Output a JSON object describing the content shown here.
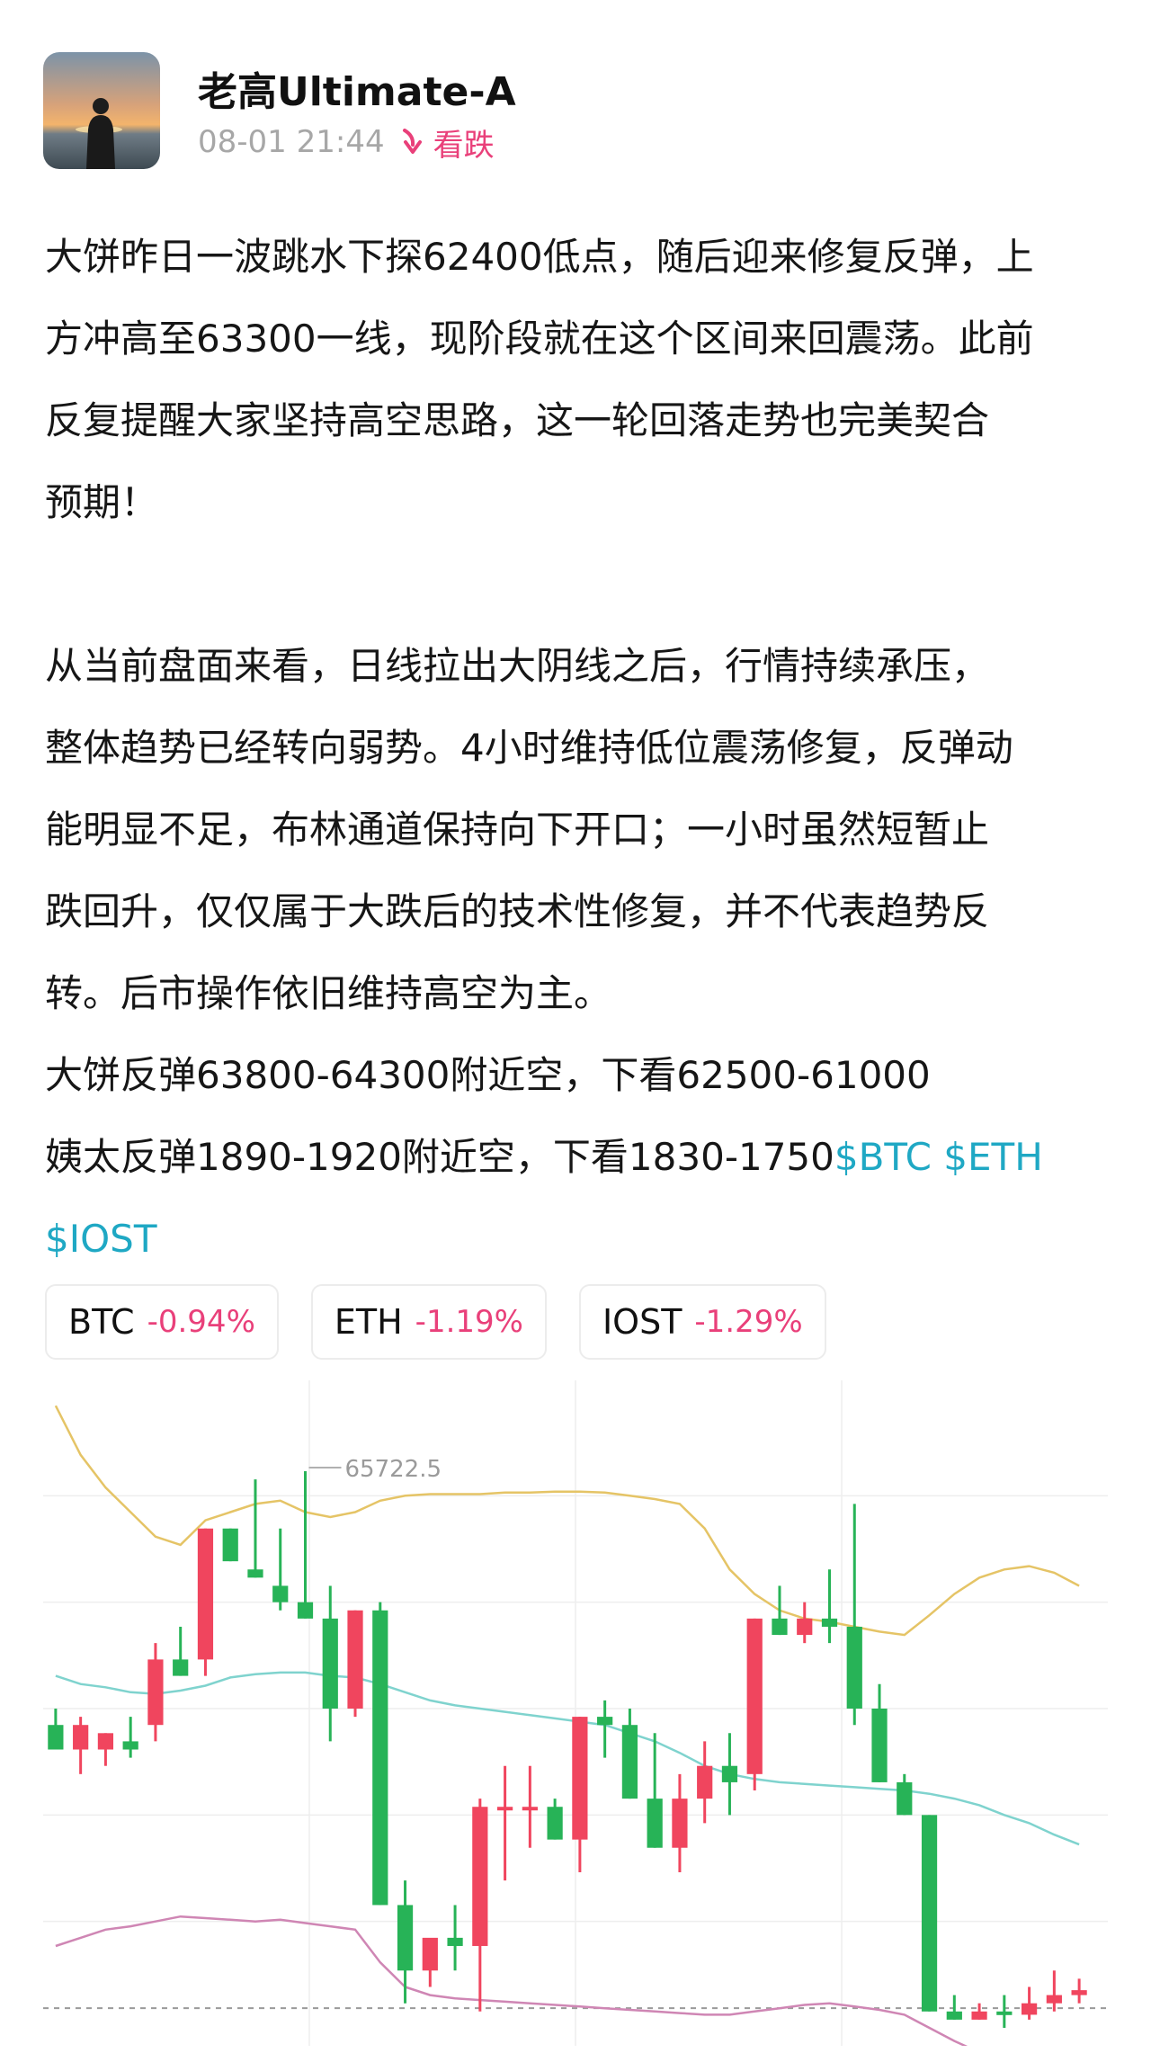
{
  "post": {
    "author": "老高Ultimate-A",
    "time": "08-01 21:44",
    "sentiment": "看跌",
    "colors": {
      "sentiment": "#e9407a",
      "tag": "#1fa8c4",
      "up": "#f0455e",
      "down": "#27b357"
    },
    "body": {
      "line1": "大饼昨日一波跳水下探62400低点，随后迎来修复反弹，上",
      "line2": "方冲高至63300一线，现阶段就在这个区间来回震荡。此前",
      "line3": "反复提醒大家坚持高空思路，这一轮回落走势也完美契合",
      "line4": "预期！",
      "line5": "从当前盘面来看，日线拉出大阴线之后，行情持续承压，",
      "line6": "整体趋势已经转向弱势。4小时维持低位震荡修复，反弹动",
      "line7": "能明显不足，布林通道保持向下开口；一小时虽然短暂止",
      "line8": "跌回升，仅仅属于大跌后的技术性修复，并不代表趋势反",
      "line9": "转。后市操作依旧维持高空为主。",
      "line10": "大饼反弹63800-64300附近空，下看62500-61000",
      "line11": "姨太反弹1890-1920附近空，下看1830-1750",
      "tag_btc": "$BTC",
      "tag_eth": "$ETH",
      "tag_iost": "$IOST"
    },
    "coins": [
      {
        "symbol": "BTC",
        "change": "-0.94%"
      },
      {
        "symbol": "ETH",
        "change": "-1.19%"
      },
      {
        "symbol": "IOST",
        "change": "-1.29%"
      }
    ]
  },
  "chart_data": {
    "type": "candlestick",
    "high_label": "65722.5",
    "candles": [
      {
        "o": 64150,
        "h": 64250,
        "l": 64000,
        "c": 64000
      },
      {
        "o": 64000,
        "h": 64200,
        "l": 63850,
        "c": 64150
      },
      {
        "o": 64000,
        "h": 64100,
        "l": 63900,
        "c": 64100
      },
      {
        "o": 64050,
        "h": 64200,
        "l": 63950,
        "c": 64000
      },
      {
        "o": 64150,
        "h": 64650,
        "l": 64050,
        "c": 64550
      },
      {
        "o": 64550,
        "h": 64750,
        "l": 64450,
        "c": 64450
      },
      {
        "o": 64550,
        "h": 65350,
        "l": 64450,
        "c": 65350
      },
      {
        "o": 65350,
        "h": 65350,
        "l": 65150,
        "c": 65150
      },
      {
        "o": 65100,
        "h": 65650,
        "l": 65050,
        "c": 65050
      },
      {
        "o": 65000,
        "h": 65350,
        "l": 64850,
        "c": 64900
      },
      {
        "o": 64900,
        "h": 65700,
        "l": 64800,
        "c": 64800
      },
      {
        "o": 64800,
        "h": 65000,
        "l": 64050,
        "c": 64250
      },
      {
        "o": 64250,
        "h": 64850,
        "l": 64200,
        "c": 64850
      },
      {
        "o": 64850,
        "h": 64900,
        "l": 63050,
        "c": 63050
      },
      {
        "o": 63050,
        "h": 63200,
        "l": 62450,
        "c": 62650
      },
      {
        "o": 62650,
        "h": 62800,
        "l": 62550,
        "c": 62850
      },
      {
        "o": 62850,
        "h": 63050,
        "l": 62650,
        "c": 62800
      },
      {
        "o": 62800,
        "h": 63700,
        "l": 62400,
        "c": 63650
      },
      {
        "o": 63650,
        "h": 63900,
        "l": 63200,
        "c": 63650
      },
      {
        "o": 63650,
        "h": 63900,
        "l": 63400,
        "c": 63650
      },
      {
        "o": 63650,
        "h": 63700,
        "l": 63450,
        "c": 63450
      },
      {
        "o": 63450,
        "h": 64200,
        "l": 63250,
        "c": 64200
      },
      {
        "o": 64200,
        "h": 64300,
        "l": 63950,
        "c": 64150
      },
      {
        "o": 64150,
        "h": 64250,
        "l": 63700,
        "c": 63700
      },
      {
        "o": 63700,
        "h": 64100,
        "l": 63400,
        "c": 63400
      },
      {
        "o": 63400,
        "h": 63850,
        "l": 63250,
        "c": 63700
      },
      {
        "o": 63700,
        "h": 64050,
        "l": 63550,
        "c": 63900
      },
      {
        "o": 63900,
        "h": 64100,
        "l": 63600,
        "c": 63800
      },
      {
        "o": 63850,
        "h": 64800,
        "l": 63750,
        "c": 64800
      },
      {
        "o": 64800,
        "h": 65000,
        "l": 64700,
        "c": 64700
      },
      {
        "o": 64700,
        "h": 64900,
        "l": 64650,
        "c": 64800
      },
      {
        "o": 64800,
        "h": 65100,
        "l": 64650,
        "c": 64750
      },
      {
        "o": 64750,
        "h": 65500,
        "l": 64150,
        "c": 64250
      },
      {
        "o": 64250,
        "h": 64400,
        "l": 63800,
        "c": 63800
      },
      {
        "o": 63800,
        "h": 63850,
        "l": 63600,
        "c": 63600
      },
      {
        "o": 63600,
        "h": 63600,
        "l": 62400,
        "c": 62400
      },
      {
        "o": 62400,
        "h": 62500,
        "l": 62350,
        "c": 62350
      },
      {
        "o": 62350,
        "h": 62450,
        "l": 62350,
        "c": 62400
      },
      {
        "o": 62400,
        "h": 62500,
        "l": 62300,
        "c": 62380
      },
      {
        "o": 62380,
        "h": 62550,
        "l": 62350,
        "c": 62450
      },
      {
        "o": 62450,
        "h": 62650,
        "l": 62400,
        "c": 62500
      },
      {
        "o": 62500,
        "h": 62600,
        "l": 62450,
        "c": 62530
      }
    ],
    "boll_upper": [
      66100,
      65800,
      65600,
      65450,
      65300,
      65250,
      65400,
      65450,
      65500,
      65520,
      65450,
      65420,
      65450,
      65520,
      65550,
      65560,
      65560,
      65560,
      65570,
      65570,
      65575,
      65575,
      65570,
      65550,
      65530,
      65500,
      65350,
      65100,
      64950,
      64850,
      64800,
      64780,
      64750,
      64720,
      64700,
      64820,
      64950,
      65050,
      65100,
      65120,
      65080,
      65000
    ],
    "boll_mid": [
      64450,
      64400,
      64380,
      64350,
      64340,
      64360,
      64390,
      64440,
      64460,
      64470,
      64470,
      64450,
      64440,
      64400,
      64350,
      64300,
      64270,
      64250,
      64230,
      64210,
      64190,
      64170,
      64150,
      64100,
      64050,
      63980,
      63900,
      63850,
      63820,
      63800,
      63790,
      63780,
      63770,
      63760,
      63750,
      63730,
      63700,
      63660,
      63600,
      63550,
      63480,
      63420
    ],
    "boll_lower": [
      62800,
      62850,
      62900,
      62920,
      62950,
      62980,
      62970,
      62960,
      62950,
      62960,
      62940,
      62920,
      62900,
      62700,
      62550,
      62500,
      62480,
      62470,
      62460,
      62450,
      62440,
      62430,
      62420,
      62410,
      62400,
      62390,
      62380,
      62380,
      62400,
      62420,
      62440,
      62450,
      62430,
      62410,
      62380,
      62300,
      62220,
      62150,
      62120,
      62100,
      62080,
      62060
    ],
    "colors": {
      "upper": "#e5c466",
      "mid": "#7fd3ce",
      "lower": "#cf86b4",
      "grid": "#eeeeee"
    }
  }
}
